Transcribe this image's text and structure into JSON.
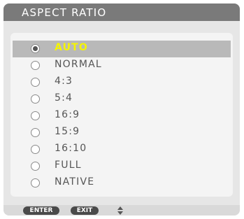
{
  "title": "ASPECT RATIO",
  "options": [
    {
      "label": "AUTO",
      "selected": true
    },
    {
      "label": "NORMAL",
      "selected": false
    },
    {
      "label": "4:3",
      "selected": false
    },
    {
      "label": "5:4",
      "selected": false
    },
    {
      "label": "16:9",
      "selected": false
    },
    {
      "label": "15:9",
      "selected": false
    },
    {
      "label": "16:10",
      "selected": false
    },
    {
      "label": "FULL",
      "selected": false
    },
    {
      "label": "NATIVE",
      "selected": false
    }
  ],
  "footer": {
    "enter_label": "ENTER",
    "exit_label": "EXIT",
    "updown_icon": "up-down-arrows-icon"
  },
  "colors": {
    "title_bar": "#7a7a7a",
    "selected_row": "#b9b9b9",
    "selected_text": "#f5f500",
    "key_bg": "#4a4a4a"
  }
}
